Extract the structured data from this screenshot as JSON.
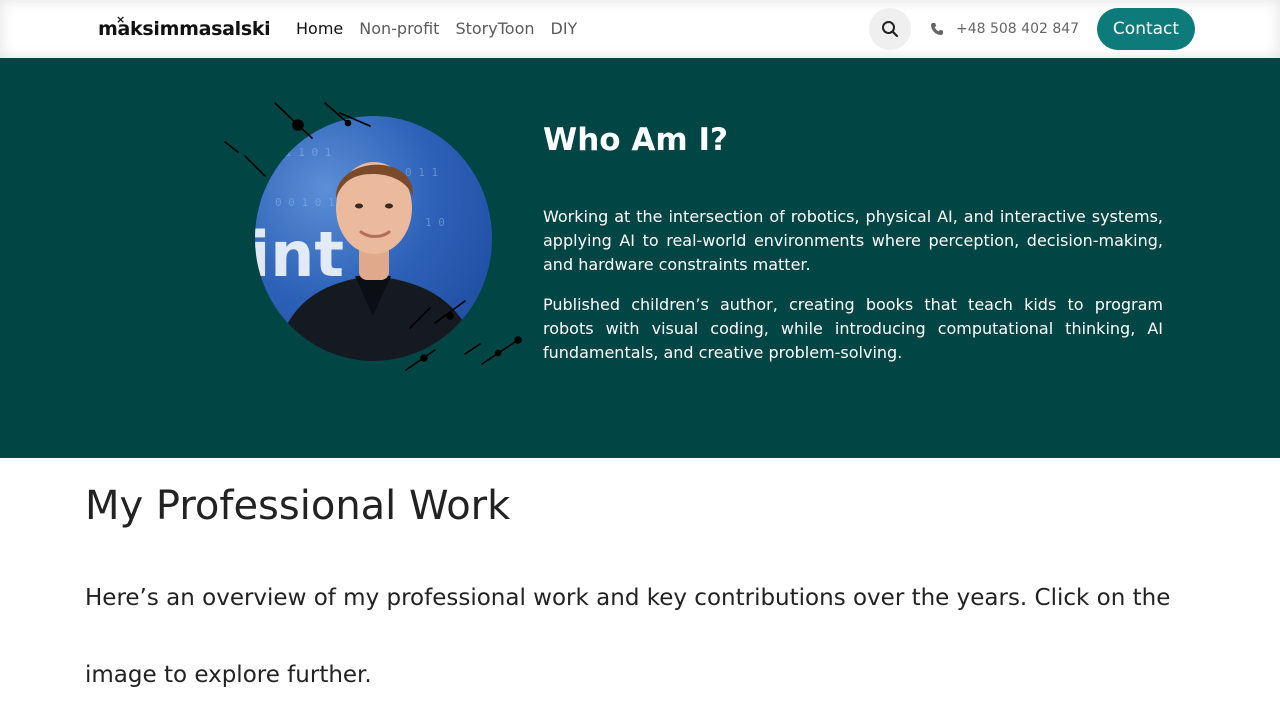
{
  "header": {
    "logo_text": "maksimmasalski",
    "logo_mark": "×",
    "nav": [
      {
        "label": "Home",
        "active": true
      },
      {
        "label": "Non-profit",
        "active": false
      },
      {
        "label": "StoryToon",
        "active": false
      },
      {
        "label": "DIY",
        "active": false
      }
    ],
    "search_icon": "search-icon",
    "phone_icon": "phone-icon",
    "phone": "+48 508 402 847",
    "contact_label": "Contact"
  },
  "hero": {
    "title": "Who Am I?",
    "paragraph1": "Working at the intersection of robotics, physical AI, and interactive systems, applying AI to real-world environments where perception, decision-making, and hardware constraints matter.",
    "paragraph2": "Published children’s author, creating books that teach kids to program robots with visual coding, while introducing computational thinking, AI fundamentals, and creative problem-solving."
  },
  "work": {
    "title": "My Professional Work",
    "intro": "Here’s an overview of my professional work and key contributions over the years. Click on the image to explore further."
  },
  "colors": {
    "hero_bg": "#014545",
    "accent": "#0c7b79",
    "text": "#222222"
  }
}
